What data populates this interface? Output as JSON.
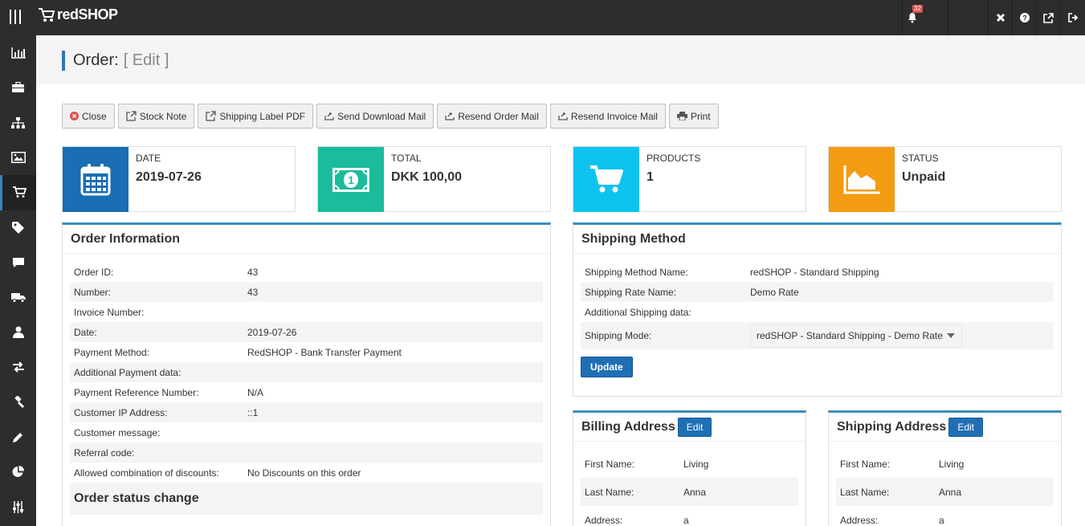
{
  "app": {
    "brand": "redSHOP",
    "notification_count": "32"
  },
  "page": {
    "title": "Order:",
    "subtitle": "[ Edit ]"
  },
  "toolbar": {
    "close": "Close",
    "stock_note": "Stock Note",
    "shipping_label": "Shipping Label PDF",
    "send_download": "Send Download Mail",
    "resend_order": "Resend Order Mail",
    "resend_invoice": "Resend Invoice Mail",
    "print": "Print"
  },
  "cards": {
    "date": {
      "label": "DATE",
      "value": "2019-07-26",
      "color": "#1a6eb3"
    },
    "total": {
      "label": "TOTAL",
      "value": "DKK 100,00",
      "color": "#1abc9c"
    },
    "products": {
      "label": "PRODUCTS",
      "value": "1",
      "color": "#0ec4ef"
    },
    "status": {
      "label": "STATUS",
      "value": "Unpaid",
      "color": "#f39c12"
    }
  },
  "order_info": {
    "title": "Order Information",
    "rows": [
      {
        "k": "Order ID:",
        "v": "43"
      },
      {
        "k": "Number:",
        "v": "43"
      },
      {
        "k": "Invoice Number:",
        "v": ""
      },
      {
        "k": "Date:",
        "v": "2019-07-26"
      },
      {
        "k": "Payment Method:",
        "v": "RedSHOP - Bank Transfer Payment"
      },
      {
        "k": "Additional Payment data:",
        "v": ""
      },
      {
        "k": "Payment Reference Number:",
        "v": "N/A"
      },
      {
        "k": "Customer IP Address:",
        "v": "::1"
      },
      {
        "k": "Customer message:",
        "v": ""
      },
      {
        "k": "Referral code:",
        "v": ""
      },
      {
        "k": "Allowed combination of discounts:",
        "v": "No Discounts on this order"
      }
    ],
    "status_change_title": "Order status change"
  },
  "shipping_method": {
    "title": "Shipping Method",
    "rows": [
      {
        "k": "Shipping Method Name:",
        "v": "redSHOP - Standard Shipping"
      },
      {
        "k": "Shipping Rate Name:",
        "v": "Demo Rate"
      },
      {
        "k": "Additional Shipping data:",
        "v": ""
      }
    ],
    "mode_label": "Shipping Mode:",
    "mode_value": "redSHOP - Standard Shipping - Demo Rate",
    "update_label": "Update"
  },
  "billing": {
    "title": "Billing Address",
    "edit_label": "Edit",
    "rows": [
      {
        "k": "First Name:",
        "v": "Living"
      },
      {
        "k": "Last Name:",
        "v": "Anna"
      },
      {
        "k": "Address:",
        "v": "a"
      }
    ]
  },
  "shipping_address": {
    "title": "Shipping Address",
    "edit_label": "Edit",
    "rows": [
      {
        "k": "First Name:",
        "v": "Living"
      },
      {
        "k": "Last Name:",
        "v": "Anna"
      },
      {
        "k": "Address:",
        "v": "a"
      }
    ]
  }
}
